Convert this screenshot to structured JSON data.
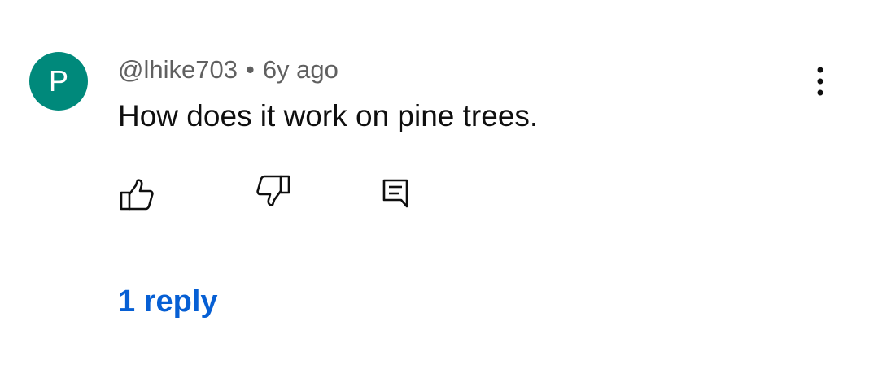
{
  "comment": {
    "avatar_letter": "P",
    "author": "@lhike703",
    "separator": "•",
    "age": "6y ago",
    "text": "How does it work on pine trees."
  },
  "actions": {
    "like_icon": "thumbs-up-icon",
    "dislike_icon": "thumbs-down-icon",
    "reply_icon": "comment-reply-icon",
    "more_icon": "more-vertical-icon"
  },
  "replies": {
    "label": "1 reply"
  },
  "colors": {
    "avatar_bg": "#00897b",
    "link": "#065fd4",
    "meta_text": "#606060",
    "body_text": "#0f0f0f"
  }
}
